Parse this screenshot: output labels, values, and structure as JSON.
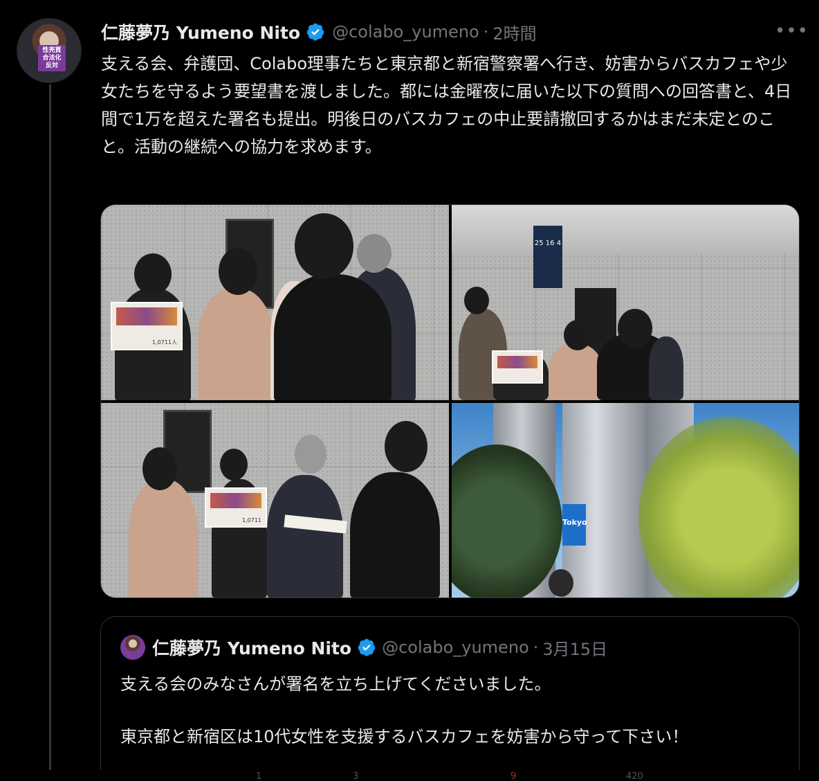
{
  "tweet": {
    "author_name": "仁藤夢乃 Yumeno Nito",
    "handle": "@colabo_yumeno",
    "separator": "·",
    "time": "2時間",
    "more_label": "•••",
    "text": "支える会、弁護団、Colabo理事たちと東京都と新宿警察署へ行き、妨害からバスカフェや少女たちを守るよう要望書を渡しました。都には金曜夜に届いた以下の質問への回答書と、4日間で1万を超えた署名も提出。明後日のバスカフェの中止要請撤回するかはまだ未定とのこと。活動の継続への協力を求めます。",
    "avatar_sign_text": "性売買\n合法化\n反対",
    "photos": [
      {
        "placard_count": "1,0711人"
      },
      {
        "sign_top": "25 16 4"
      },
      {
        "placard_count": "1,0711"
      },
      {
        "banner": "Tokyo"
      }
    ]
  },
  "quoted_tweet": {
    "author_name": "仁藤夢乃 Yumeno Nito",
    "handle": "@colabo_yumeno",
    "separator": "·",
    "time": "3月15日",
    "text": "支える会のみなさんが署名を立ち上げてくださいました。\n\n東京都と新宿区は10代女性を支援するバスカフェを妨害から守って下さい！"
  },
  "action_bar_partial": {
    "replies": "1",
    "retweets": "3",
    "likes": "9",
    "views": "420"
  },
  "colors": {
    "background": "#000000",
    "text": "#e7e9ea",
    "muted": "#71767b",
    "verified": "#1d9bf0",
    "border": "#2f3336"
  }
}
